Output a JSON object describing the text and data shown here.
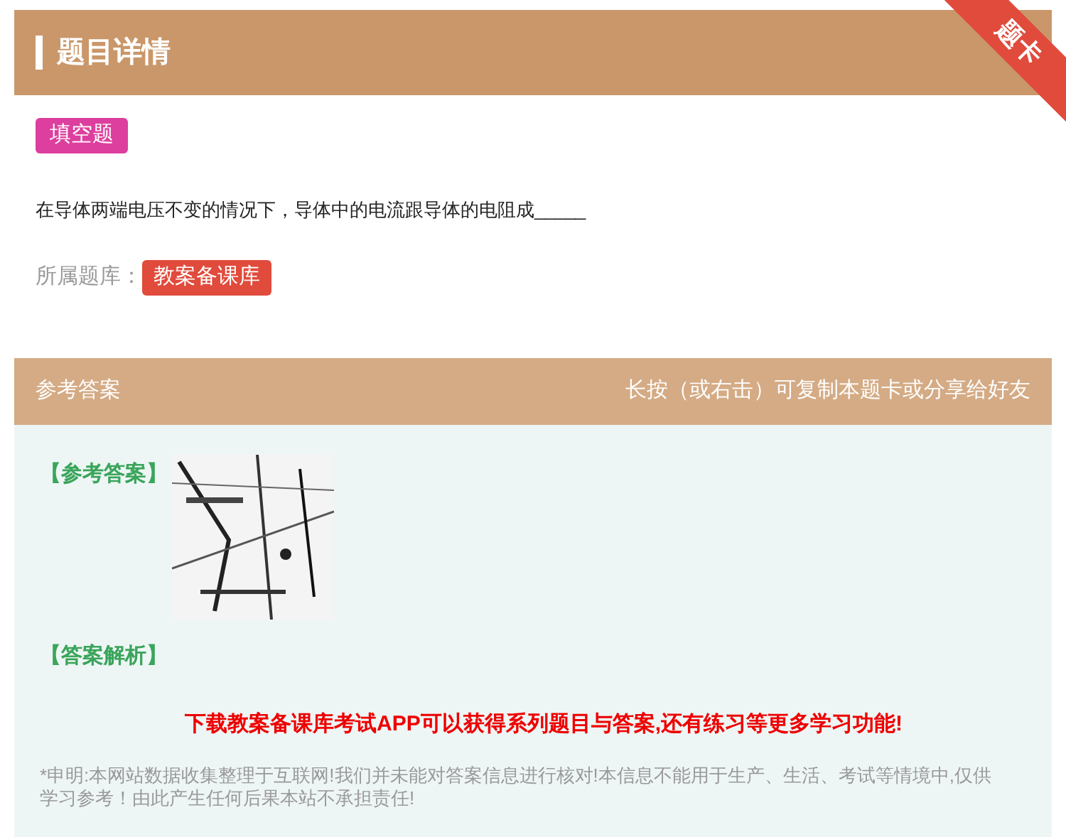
{
  "header": {
    "title": "题目详情",
    "ribbon": "题卡"
  },
  "question": {
    "type_tag": "填空题",
    "text": "在导体两端电压不变的情况下，导体中的电流跟导体的电阻成_____",
    "bank_label": "所属题库：",
    "bank_tag": "教案备课库"
  },
  "answer_bar": {
    "title": "参考答案",
    "hint": "长按（或右击）可复制本题卡或分享给好友"
  },
  "answer": {
    "answer_label": "【参考答案】",
    "analysis_label": "【答案解析】",
    "promo": "下载教案备课库考试APP可以获得系列题目与答案,还有练习等更多学习功能!",
    "disclaimer": "*申明:本网站数据收集整理于互联网!我们并未能对答案信息进行核对!本信息不能用于生产、生活、考试等情境中,仅供学习参考！由此产生任何后果本站不承担责任!"
  }
}
